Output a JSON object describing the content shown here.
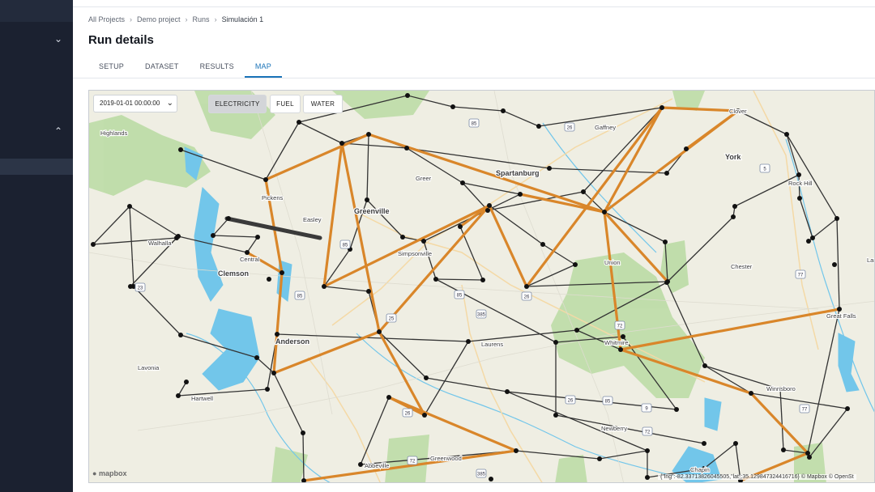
{
  "breadcrumb": [
    "All Projects",
    "Demo project",
    "Runs",
    "Simulación 1"
  ],
  "page_title": "Run details",
  "tabs": [
    {
      "label": "SETUP",
      "active": false
    },
    {
      "label": "DATASET",
      "active": false
    },
    {
      "label": "RESULTS",
      "active": false
    },
    {
      "label": "MAP",
      "active": true
    }
  ],
  "map": {
    "date_value": "2019-01-01 00:00:00",
    "layer_buttons": [
      {
        "label": "ELECTRICITY",
        "active": true
      },
      {
        "label": "FUEL",
        "active": false
      },
      {
        "label": "WATER",
        "active": false
      }
    ],
    "logo": "mapbox",
    "coordinates": "{\"lng\":-82.33713826045505,\"lat\":35.129847324416716}",
    "attribution": "© Mapbox © OpenSt",
    "place_labels": [
      "Highlands",
      "Pickens",
      "Easley",
      "Greenville",
      "Greer",
      "Spartanburg",
      "Gaffney",
      "Clover",
      "York",
      "Rock Hill",
      "Walhalla",
      "Central",
      "Clemson",
      "Simpsonville",
      "Chester",
      "Union",
      "Anderson",
      "Laurens",
      "Whitmire",
      "Great Falls",
      "Lavonia",
      "Hartwell",
      "Winnsboro",
      "Newberry",
      "Greenwood",
      "Abbeville",
      "Chapin",
      "Lanc"
    ],
    "road_shields": [
      "85",
      "26",
      "85",
      "85",
      "5",
      "77",
      "85",
      "385",
      "26",
      "72",
      "25",
      "385",
      "26",
      "9",
      "72",
      "77",
      "85",
      "26",
      "23",
      "72"
    ],
    "colors": {
      "electricity_line": "#d9862a",
      "network_line": "#2e2e2e",
      "water": "#6fc4e8",
      "forest": "#b6d9a0",
      "land": "#efeee3",
      "accent": "#1a73b8"
    }
  }
}
